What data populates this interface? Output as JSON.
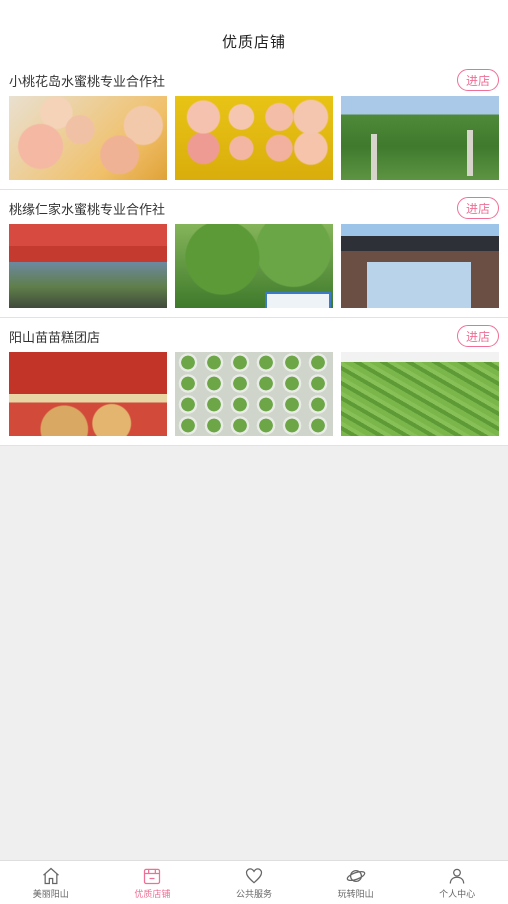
{
  "header": {
    "title": "优质店铺"
  },
  "stores": [
    {
      "name": "小桃花岛水蜜桃专业合作社",
      "enter_label": "进店"
    },
    {
      "name": "桃缘仁家水蜜桃专业合作社",
      "enter_label": "进店"
    },
    {
      "name": "阳山苗苗糕团店",
      "enter_label": "进店"
    }
  ],
  "tabbar": {
    "active_color": "#ef6f96",
    "items": [
      {
        "label": "美丽阳山",
        "icon": "home-icon"
      },
      {
        "label": "优质店铺",
        "icon": "store-icon",
        "active": true
      },
      {
        "label": "公共服务",
        "icon": "heart-icon"
      },
      {
        "label": "玩转阳山",
        "icon": "planet-icon"
      },
      {
        "label": "个人中心",
        "icon": "person-icon"
      }
    ]
  }
}
